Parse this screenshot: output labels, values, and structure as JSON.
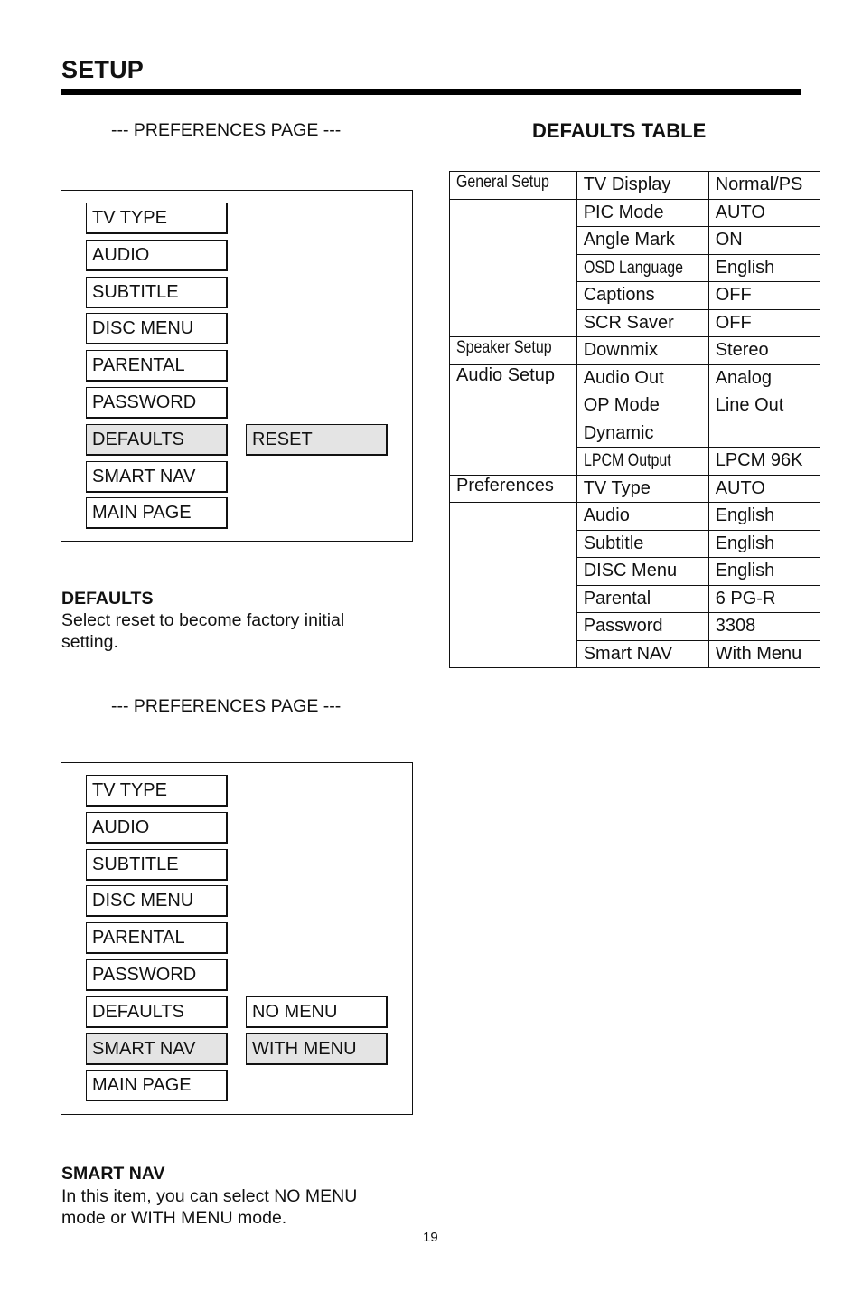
{
  "page": {
    "title": "SETUP",
    "page_number": "19"
  },
  "section1": {
    "heading": "--- PREFERENCES PAGE ---",
    "menu_items": [
      "TV TYPE",
      "AUDIO",
      "SUBTITLE",
      "DISC MENU",
      "PARENTAL",
      "PASSWORD",
      "DEFAULTS",
      "SMART NAV",
      "MAIN PAGE"
    ],
    "selected_item": "DEFAULTS",
    "submenu_options": [
      "RESET"
    ],
    "selected_option": "RESET",
    "desc_title": "DEFAULTS",
    "desc_body": "Select reset to become factory initial setting."
  },
  "section2": {
    "heading": "--- PREFERENCES PAGE ---",
    "menu_items": [
      "TV TYPE",
      "AUDIO",
      "SUBTITLE",
      "DISC MENU",
      "PARENTAL",
      "PASSWORD",
      "DEFAULTS",
      "SMART NAV",
      "MAIN PAGE"
    ],
    "selected_item": "SMART NAV",
    "submenu_options": [
      "NO MENU",
      "WITH MENU"
    ],
    "selected_option": "WITH MENU",
    "desc_title": "SMART NAV",
    "desc_body": "In this item, you can select NO MENU mode or WITH MENU mode."
  },
  "defaults_table": {
    "title": "DEFAULTS TABLE",
    "groups": [
      {
        "category": "General Setup",
        "rows": [
          [
            "TV Display",
            "Normal/PS"
          ],
          [
            "PIC Mode",
            "AUTO"
          ],
          [
            "Angle Mark",
            "ON"
          ],
          [
            "OSD Language",
            "English"
          ],
          [
            "Captions",
            "OFF"
          ],
          [
            "SCR Saver",
            "OFF"
          ]
        ]
      },
      {
        "category": "Speaker Setup",
        "rows": [
          [
            "Downmix",
            "Stereo"
          ]
        ]
      },
      {
        "category": "Audio Setup",
        "rows": [
          [
            "Audio Out",
            "Analog"
          ],
          [
            "OP Mode",
            "Line Out"
          ],
          [
            "Dynamic",
            ""
          ],
          [
            "LPCM Output",
            "LPCM 96K"
          ]
        ]
      },
      {
        "category": "Preferences",
        "rows": [
          [
            "TV Type",
            "AUTO"
          ],
          [
            "Audio",
            "English"
          ],
          [
            "Subtitle",
            "English"
          ],
          [
            "DISC Menu",
            "English"
          ],
          [
            "Parental",
            "6 PG-R"
          ],
          [
            "Password",
            "3308"
          ],
          [
            "Smart NAV",
            "With Menu"
          ]
        ]
      }
    ]
  }
}
